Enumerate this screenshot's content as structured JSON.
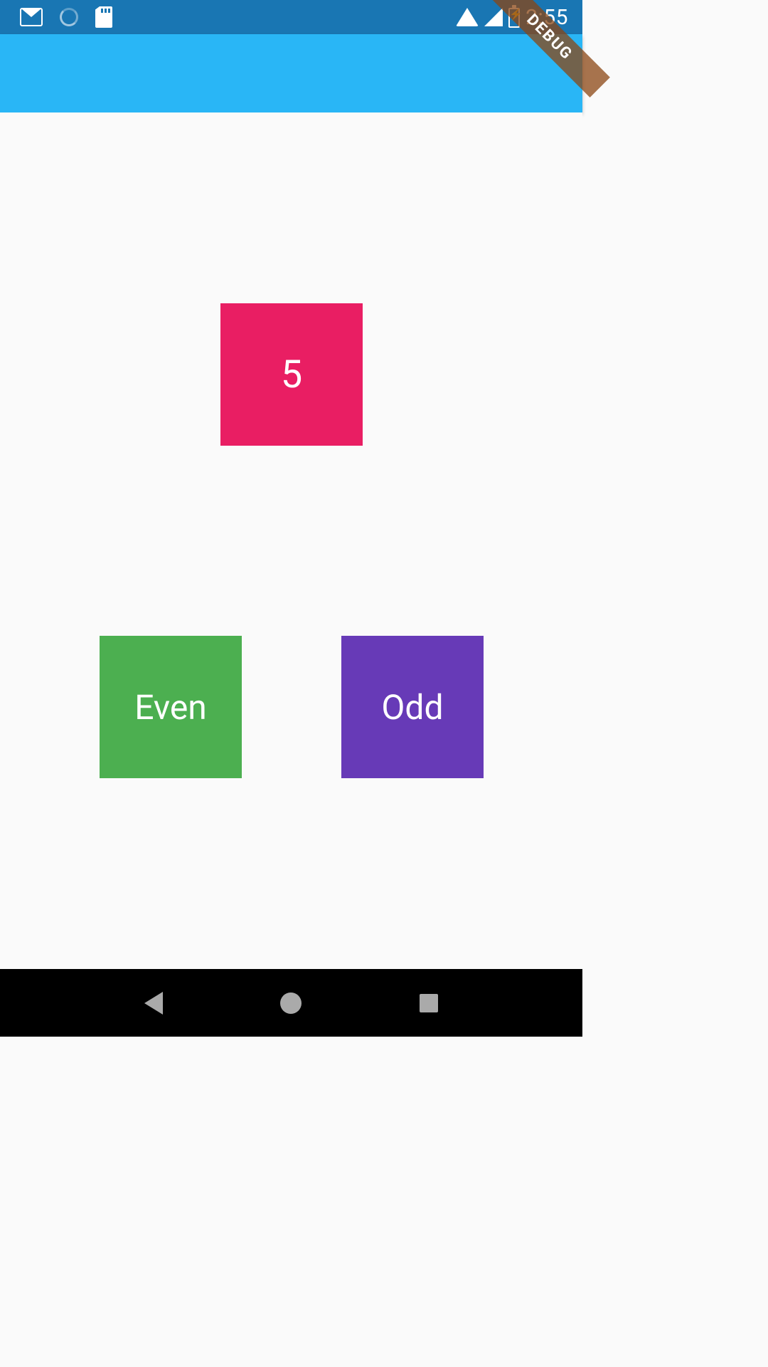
{
  "status_bar": {
    "time": "2:55"
  },
  "debug_banner": {
    "label": "DEBUG"
  },
  "game": {
    "draggable_number": "5",
    "even_target_label": "Even",
    "odd_target_label": "Odd"
  },
  "colors": {
    "status_bar": "#1976b3",
    "app_bar": "#29b6f6",
    "number_box": "#e91e63",
    "even_box": "#4caf50",
    "odd_box": "#673ab7",
    "background": "#fafafa"
  }
}
